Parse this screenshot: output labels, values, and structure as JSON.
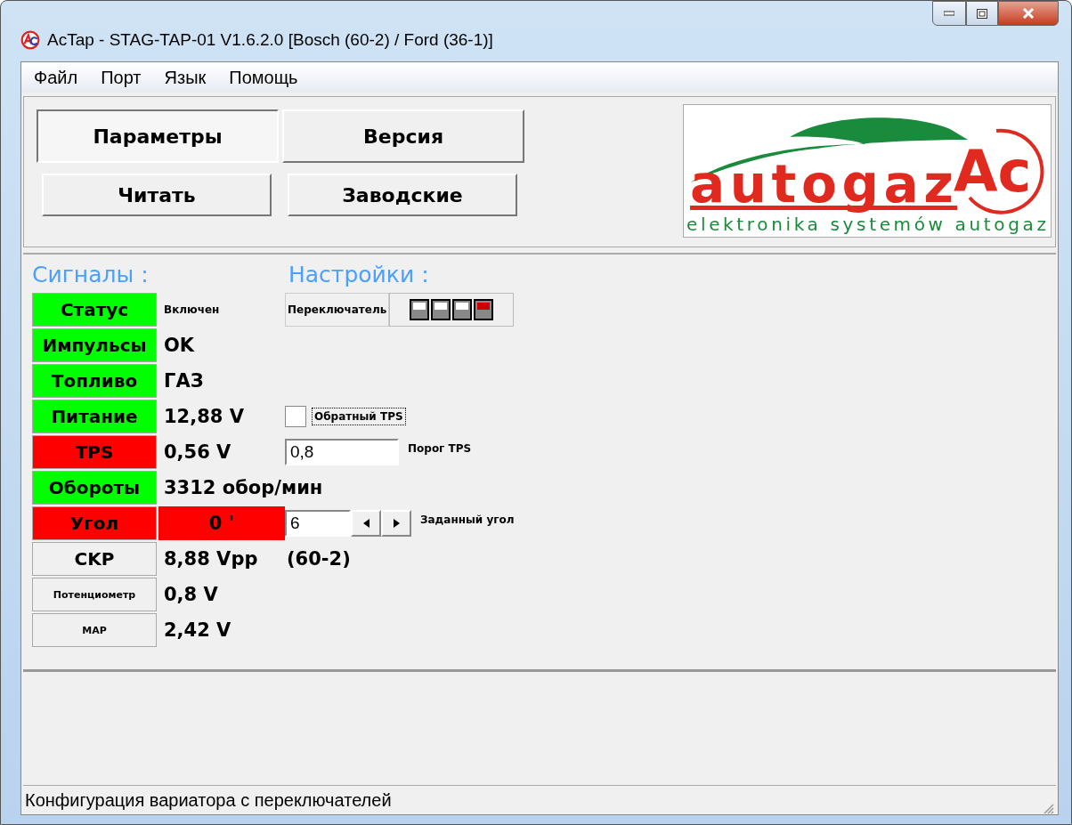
{
  "window": {
    "title": "AcTap  -  STAG-TAP-01 V1.6.2.0  [Bosch (60-2) / Ford (36-1)]"
  },
  "menu": [
    "Файл",
    "Порт",
    "Язык",
    "Помощь"
  ],
  "buttons": [
    {
      "label": "Параметры",
      "selected": true
    },
    {
      "label": "Версия",
      "selected": false
    },
    {
      "label": "Читать",
      "selected": false
    },
    {
      "label": "Заводские",
      "selected": false
    }
  ],
  "logo": {
    "wordmark": "autogaz",
    "mark": "Ac",
    "tagline": "elektronika systemów autogaz"
  },
  "signals_title": "Сигналы :",
  "settings_title": "Настройки :",
  "signals": [
    {
      "label": "Статус",
      "kind": "large",
      "color": "#00ff00",
      "value": {
        "text": "Включен",
        "kind": "small"
      },
      "value_highlight": false
    },
    {
      "label": "Импульсы",
      "kind": "large",
      "color": "#00ff00",
      "value": {
        "text": "OK",
        "kind": "large"
      },
      "value_highlight": false
    },
    {
      "label": "Топливо",
      "kind": "large",
      "color": "#00ff00",
      "value": {
        "text": "ГАЗ",
        "kind": "large"
      },
      "value_highlight": false
    },
    {
      "label": "Питание",
      "kind": "large",
      "color": "#00ff00",
      "value": {
        "text": "12,88 V",
        "kind": "large"
      },
      "value_highlight": false
    },
    {
      "label": "TPS",
      "kind": "large",
      "color": "#ff0000",
      "value": {
        "text": "0,56 V",
        "kind": "large"
      },
      "value_highlight": false
    },
    {
      "label": "Обороты",
      "kind": "large",
      "color": "#00ff00",
      "value": {
        "text": "3312 обор/мин",
        "kind": "large"
      },
      "value_highlight": false
    },
    {
      "label": "Угол",
      "kind": "large",
      "color": "#ff0000",
      "value": {
        "text": "0 '",
        "kind": "large"
      },
      "value_highlight": true
    },
    {
      "label": "CKP",
      "kind": "large",
      "color": "#f0f0f0",
      "value": {
        "text": "8,88 Vpp",
        "kind": "large"
      },
      "value_highlight": false,
      "extra": "(60-2)"
    },
    {
      "label": "Потенциометр",
      "kind": "small",
      "color": "#f0f0f0",
      "value": {
        "text": "0,8 V",
        "kind": "large"
      },
      "value_highlight": false
    },
    {
      "label": "MAP",
      "kind": "small",
      "color": "#f0f0f0",
      "value": {
        "text": "2,42 V",
        "kind": "large"
      },
      "value_highlight": false
    }
  ],
  "switch": {
    "label": "Переключатель",
    "positions": [
      {
        "on": false
      },
      {
        "on": false
      },
      {
        "on": false
      },
      {
        "on": true
      }
    ]
  },
  "reverse_tps": {
    "label": "Обратный TPS",
    "checked": false
  },
  "tps_threshold": {
    "value": "0,8",
    "label": "Порог TPS"
  },
  "angle": {
    "value": "6",
    "label": "Заданный угол"
  },
  "status_bar": "Конфигурация вариатора с переключателей"
}
